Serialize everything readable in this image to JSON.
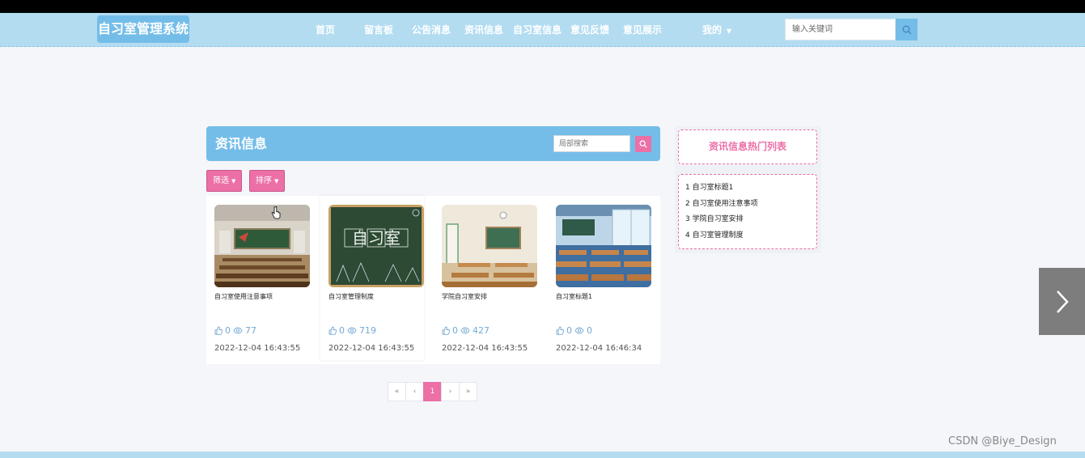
{
  "site": {
    "logo": "自习室管理系统"
  },
  "nav": {
    "items": [
      "首页",
      "留言板",
      "公告消息",
      "资讯信息",
      "自习室信息",
      "意见反馈",
      "意见展示"
    ],
    "mine": "我的",
    "search_placeholder": "输入关键词"
  },
  "panel": {
    "title": "资讯信息",
    "search_placeholder": "局部搜索",
    "filter_label": "筛选",
    "sort_label": "排序"
  },
  "cards": [
    {
      "title": "自习室使用注意事项",
      "likes": "0",
      "views": "77",
      "date": "2022-12-04 16:43:55",
      "image": "classroom-front"
    },
    {
      "title": "自习室管理制度",
      "likes": "0",
      "views": "719",
      "date": "2022-12-04 16:43:55",
      "image": "chalkboard-自习室"
    },
    {
      "title": "学院自习室安排",
      "likes": "0",
      "views": "427",
      "date": "2022-12-04 16:43:55",
      "image": "empty-classroom"
    },
    {
      "title": "自习室标题1",
      "likes": "0",
      "views": "0",
      "date": "2022-12-04 16:46:34",
      "image": "anime-classroom"
    }
  ],
  "chalkboard_text": "自习室",
  "pagination": {
    "first": "«",
    "prev": "‹",
    "current": "1",
    "next": "›",
    "last": "»"
  },
  "sidebar": {
    "title": "资讯信息热门列表",
    "items": [
      "1 自习室标题1",
      "2 自习室使用注意事项",
      "3 学院自习室安排",
      "4 自习室管理制度"
    ]
  },
  "watermark": "CSDN @Biye_Design",
  "colors": {
    "nav_bg": "#b3dcf1",
    "accent_blue": "#74bde8",
    "accent_pink": "#ec6fa6",
    "page_bg": "#f4f6fa"
  }
}
